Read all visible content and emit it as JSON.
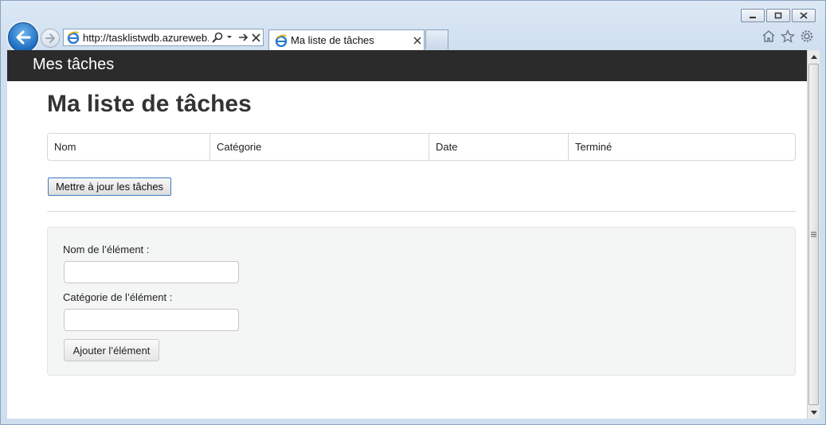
{
  "browser": {
    "address_url": "http://tasklistwdb.azureweb...",
    "tab_title": "Ma liste de tâches",
    "icons": [
      "back-icon",
      "forward-icon",
      "ie-icon",
      "search-icon",
      "dropdown-icon",
      "go-icon",
      "stop-icon",
      "close-tab-icon",
      "home-icon",
      "favorites-icon",
      "tools-gear-icon",
      "minimize-icon",
      "maximize-icon",
      "close-window-icon"
    ]
  },
  "navbar": {
    "brand": "Mes tâches"
  },
  "main": {
    "title": "Ma liste de tâches",
    "table": {
      "columns": [
        "Nom",
        "Catégorie",
        "Date",
        "Terminé"
      ]
    },
    "update_button": "Mettre à jour les tâches",
    "form": {
      "name_label": "Nom de l’élément :",
      "name_value": "",
      "category_label": "Catégorie de l’élément :",
      "category_value": "",
      "add_button": "Ajouter l’élément"
    }
  }
}
